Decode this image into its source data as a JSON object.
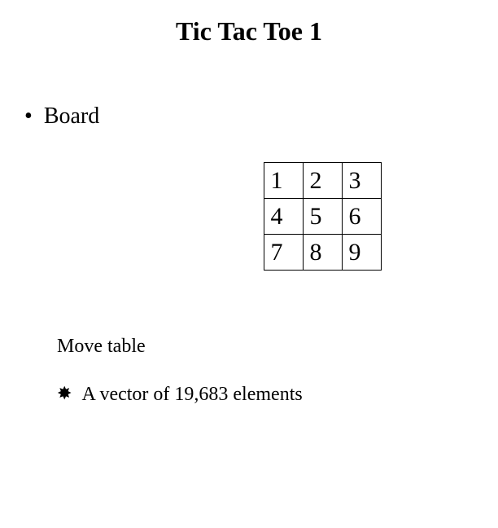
{
  "title": "Tic Tac Toe 1",
  "bullet_label": "Board",
  "board": {
    "r1c1": "1",
    "r1c2": "2",
    "r1c3": "3",
    "r2c1": "4",
    "r2c2": "5",
    "r2c3": "6",
    "r3c1": "7",
    "r3c2": "8",
    "r3c3": "9"
  },
  "sub_heading": "Move table",
  "sub_bullet": "A vector of 19,683 elements",
  "icons": {
    "bullet": "•",
    "sun": "✸"
  }
}
